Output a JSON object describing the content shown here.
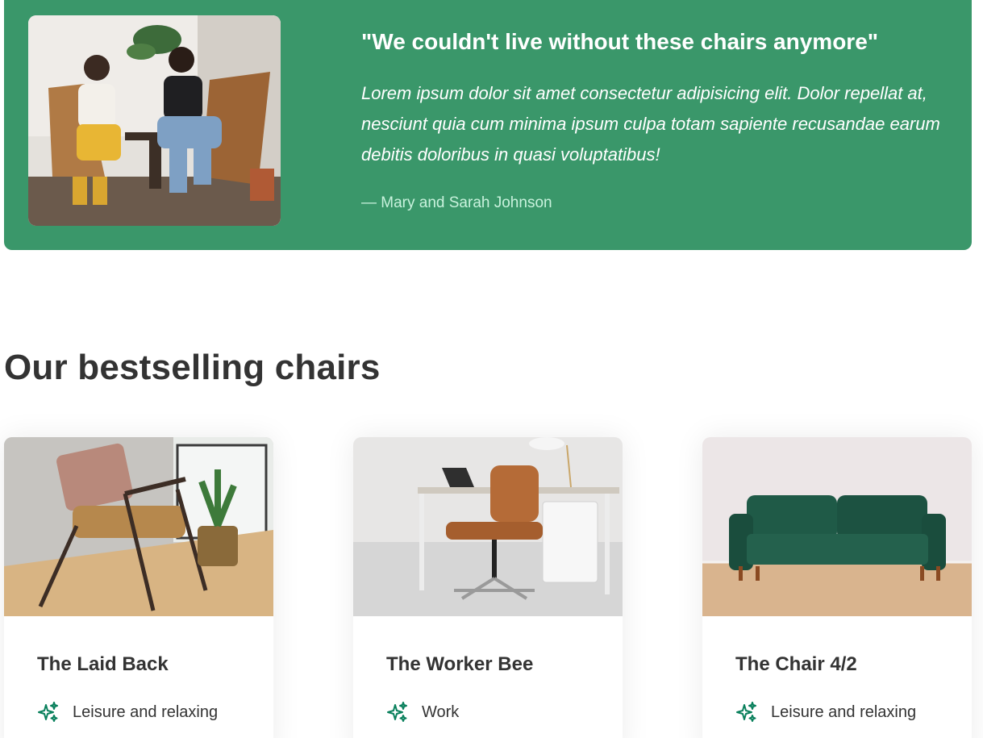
{
  "testimonial": {
    "title": "\"We couldn't live without these chairs anymore\"",
    "body": "Lorem ipsum dolor sit amet consectetur adipisicing elit. Dolor repellat at, nesciunt quia cum minima ipsum culpa totam sapiente recusandae earum debitis doloribus in quasi voluptatibus!",
    "author": "— Mary and Sarah Johnson",
    "photo_icon": "two-women-sitting-in-chairs-photo"
  },
  "bestsellers": {
    "heading": "Our bestselling chairs",
    "cards": [
      {
        "title": "The Laid Back",
        "attribute": "Leisure and relaxing",
        "icon": "sparkles-icon",
        "image": "armchair-photo"
      },
      {
        "title": "The Worker Bee",
        "attribute": "Work",
        "icon": "sparkles-icon",
        "image": "office-chair-photo"
      },
      {
        "title": "The Chair 4/2",
        "attribute": "Leisure and relaxing",
        "icon": "sparkles-icon",
        "image": "green-sofa-photo"
      }
    ]
  },
  "colors": {
    "brand_green": "#3a976a",
    "icon_green": "#087f5b",
    "heading_text": "#333333"
  }
}
